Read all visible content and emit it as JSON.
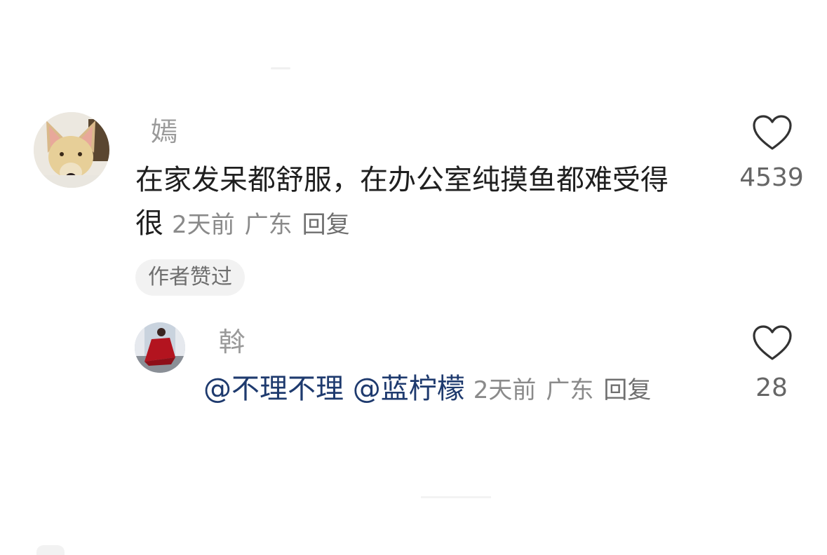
{
  "comment": {
    "username": "嫣",
    "text_line1": "在家发呆都舒服，在办公室纯摸鱼都难受得",
    "text_line2": "很",
    "time": "2天前",
    "location": "广东",
    "reply_label": "回复",
    "badge": "作者赞过",
    "likes": "4539",
    "avatar_icon": "dog-avatar"
  },
  "reply": {
    "username": "斡",
    "mention1": "@不理不理",
    "mention2": "@蓝柠檬",
    "time": "2天前",
    "location": "广东",
    "reply_label": "回复",
    "likes": "28",
    "avatar_icon": "woman-red-dress-avatar"
  },
  "colors": {
    "mention": "#1e3a6e",
    "meta": "#8a8a8a",
    "badge_bg": "#f2f2f2"
  }
}
